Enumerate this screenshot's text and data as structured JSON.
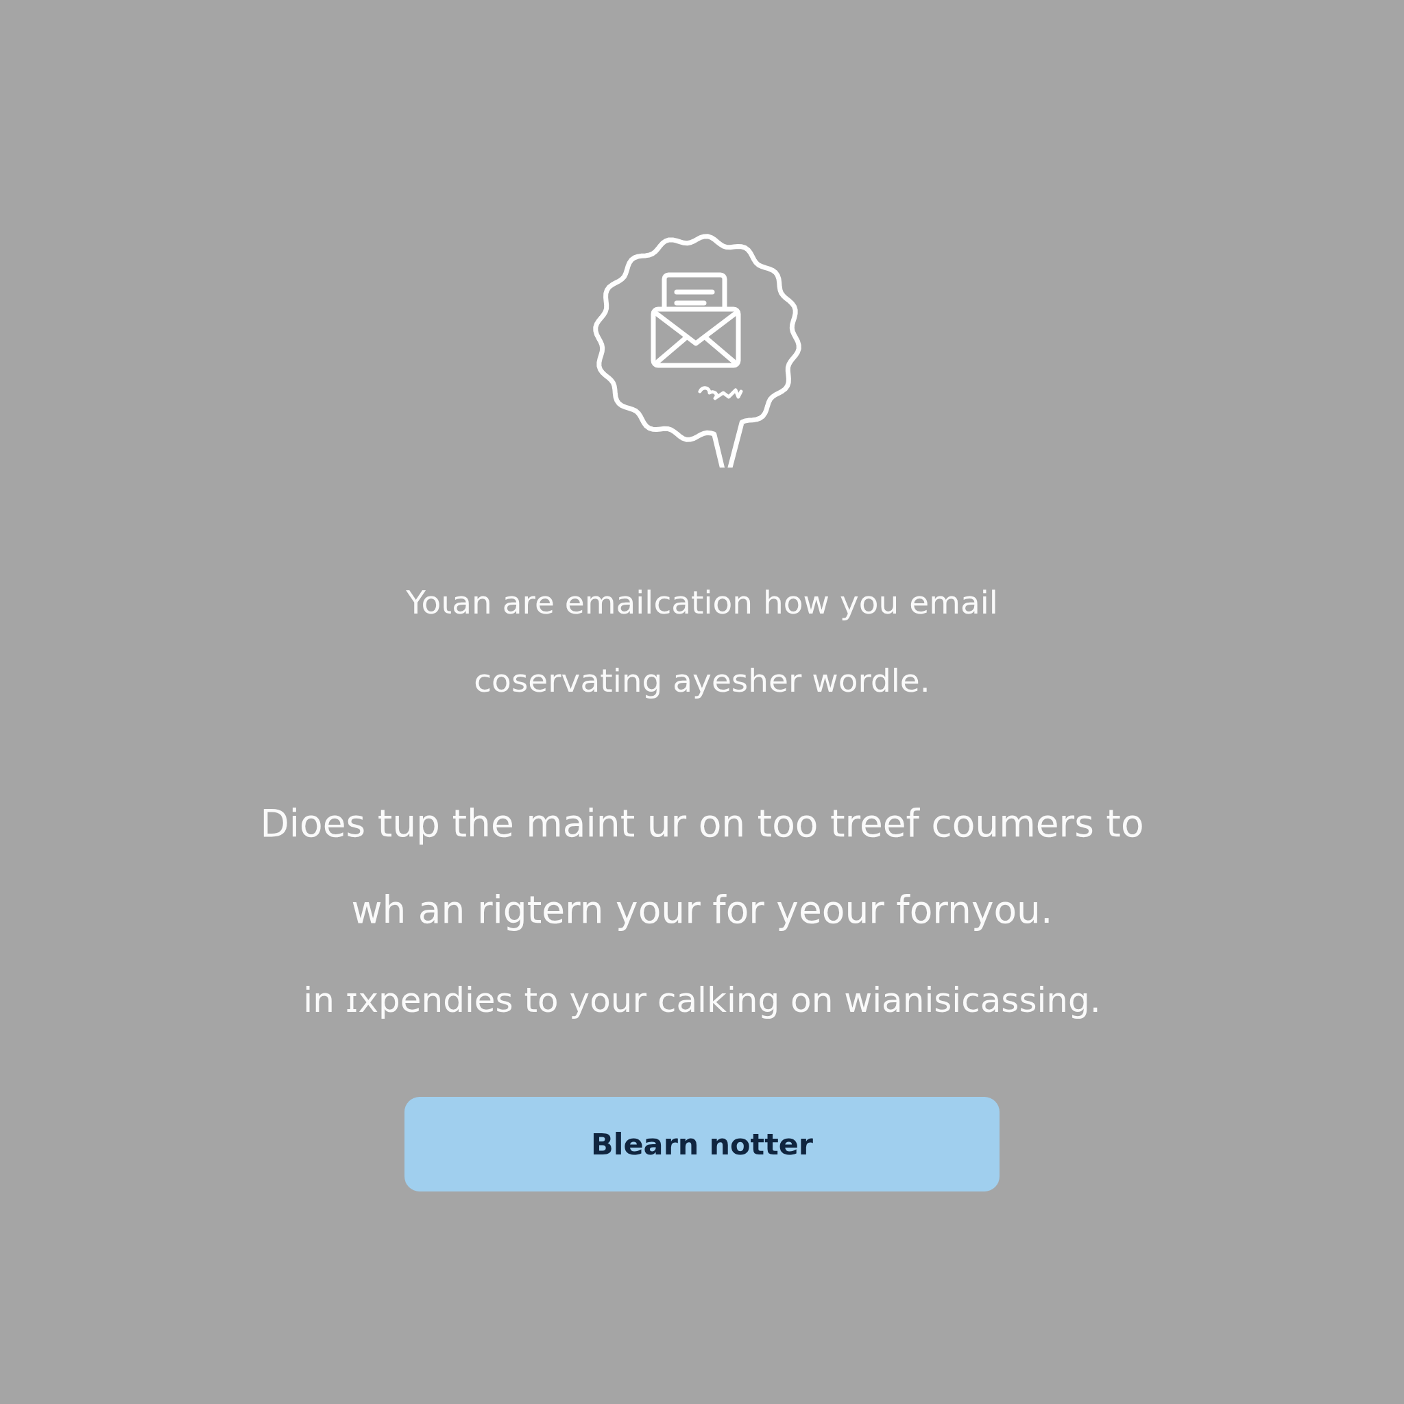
{
  "paragraphs": [
    {
      "kind": "intro",
      "lines": [
        "Yoɩan are emailcation how you email",
        "coservating ayesher wordle."
      ]
    },
    {
      "kind": "lead",
      "lines": [
        "Dioes tup the maint ur on too treef coumers to",
        "wh an rigtern your for yeour fornyou."
      ]
    },
    {
      "kind": "note",
      "lines": [
        "in ɪxpendies to your calking on wianisicassing."
      ]
    }
  ],
  "button": {
    "label": "Blearn notter"
  }
}
